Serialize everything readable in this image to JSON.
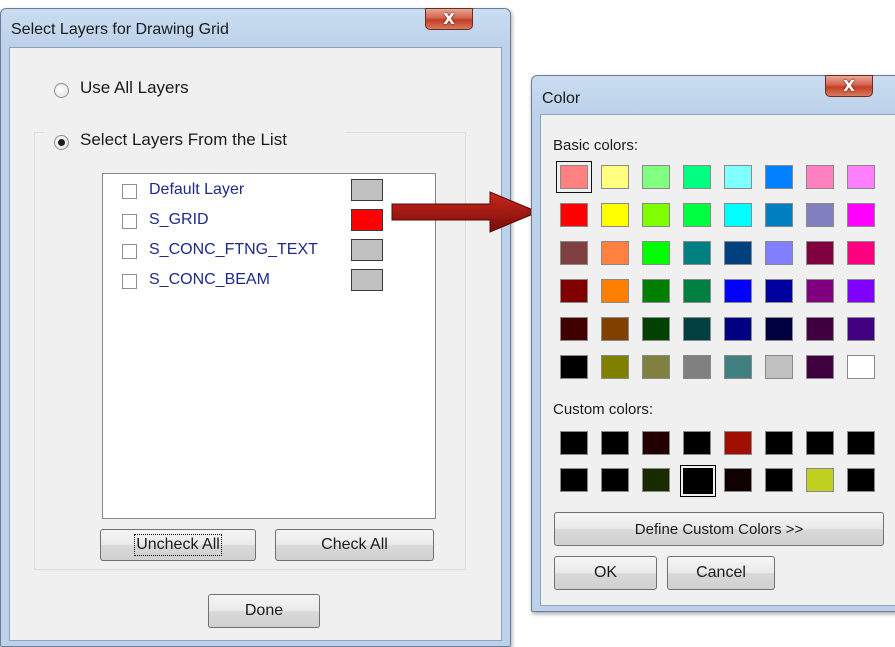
{
  "layer_dialog": {
    "title": "Select Layers for Drawing Grid",
    "close_label": "X",
    "option_all": "Use All Layers",
    "option_select": "Select Layers From the List",
    "layers": [
      {
        "name": "Default Layer",
        "checked": false,
        "color": "#c0c0c0"
      },
      {
        "name": "S_GRID",
        "checked": false,
        "color": "#ff0000"
      },
      {
        "name": "S_CONC_FTNG_TEXT",
        "checked": false,
        "color": "#c0c0c0"
      },
      {
        "name": "S_CONC_BEAM",
        "checked": false,
        "color": "#c0c0c0"
      }
    ],
    "uncheck_all": "Uncheck All",
    "check_all": "Check All",
    "done": "Done"
  },
  "color_dialog": {
    "title": "Color",
    "close_label": "X",
    "basic_label": "Basic colors:",
    "basic_colors": [
      [
        "#ff8080",
        "#ffff80",
        "#80ff80",
        "#00ff80",
        "#80ffff",
        "#0080ff",
        "#ff80c0",
        "#ff80ff"
      ],
      [
        "#ff0000",
        "#ffff00",
        "#80ff00",
        "#00ff40",
        "#00ffff",
        "#0080c0",
        "#8080c0",
        "#ff00ff"
      ],
      [
        "#804040",
        "#ff8040",
        "#00ff00",
        "#008080",
        "#004080",
        "#8080ff",
        "#800040",
        "#ff0080"
      ],
      [
        "#800000",
        "#ff8000",
        "#008000",
        "#008040",
        "#0000ff",
        "#0000a0",
        "#800080",
        "#8000ff"
      ],
      [
        "#400000",
        "#804000",
        "#004000",
        "#004040",
        "#000080",
        "#000040",
        "#400040",
        "#400080"
      ],
      [
        "#000000",
        "#808000",
        "#808040",
        "#808080",
        "#408080",
        "#c0c0c0",
        "#400040",
        "#ffffff"
      ]
    ],
    "custom_label": "Custom colors:",
    "custom_colors": [
      [
        "#000000",
        "#000000",
        "#200000",
        "#000000",
        "#a01000",
        "#000000",
        "#000000",
        "#000000"
      ],
      [
        "#000000",
        "#000000",
        "#1a2a00",
        "#000000",
        "#100000",
        "#000000",
        "#c0d020",
        "#000000"
      ]
    ],
    "define_custom": "Define Custom Colors >>",
    "ok": "OK",
    "cancel": "Cancel"
  }
}
